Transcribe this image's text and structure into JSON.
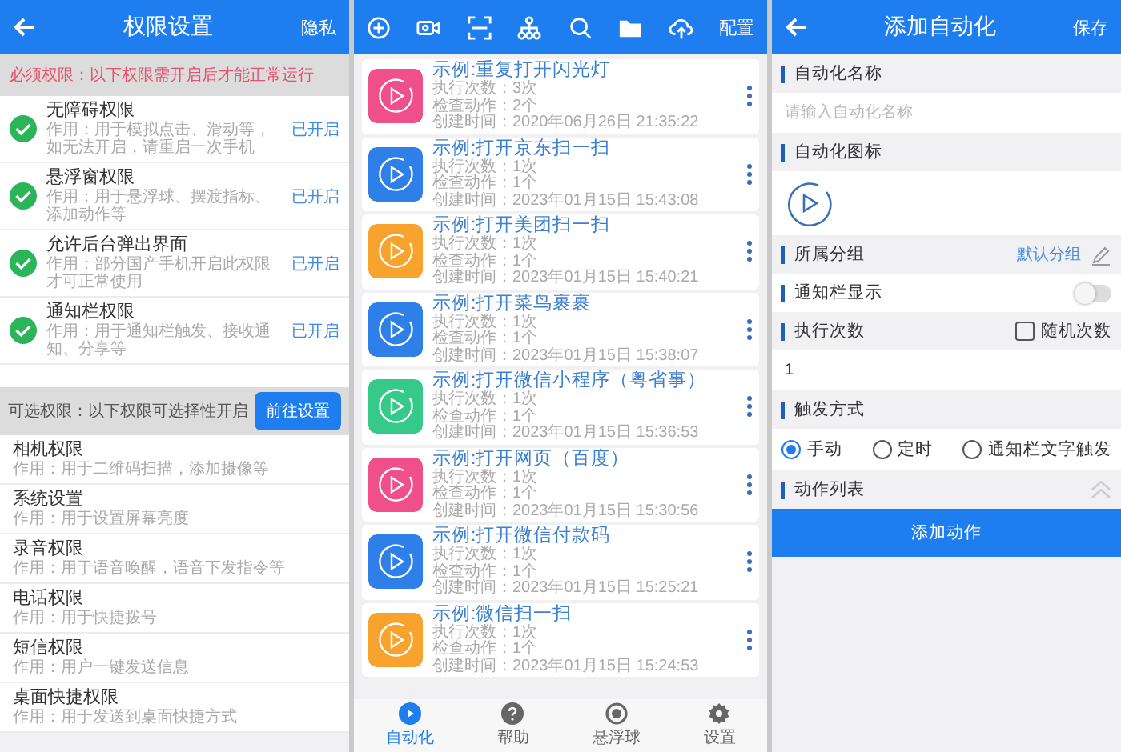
{
  "permissions_screen": {
    "title": "权限设置",
    "action": "隐私",
    "required_notice": "必须权限：以下权限需开启后才能正常运行",
    "required": [
      {
        "name": "无障碍权限",
        "description": "作用：用于模拟点击、滑动等，如无法开启，请重启一次手机",
        "status": "已开启",
        "granted": true
      },
      {
        "name": "悬浮窗权限",
        "description": "作用：用于悬浮球、摆渡指标、添加动作等",
        "status": "已开启",
        "granted": true
      },
      {
        "name": "允许后台弹出界面",
        "description": "作用：部分国产手机开启此权限才可正常使用",
        "status": "已开启",
        "granted": true
      },
      {
        "name": "通知栏权限",
        "description": "作用：用于通知栏触发、接收通知、分享等",
        "status": "已开启",
        "granted": true
      }
    ],
    "optional_notice": "可选权限：以下权限可选择性开启",
    "optional_button": "前往设置",
    "optional": [
      {
        "name": "相机权限",
        "description": "作用：用于二维码扫描，添加摄像等"
      },
      {
        "name": "系统设置",
        "description": "作用：用于设置屏幕亮度"
      },
      {
        "name": "录音权限",
        "description": "作用：用于语音唤醒，语音下发指令等"
      },
      {
        "name": "电话权限",
        "description": "作用：用于快捷拨号"
      },
      {
        "name": "短信权限",
        "description": "作用：用户一键发送信息"
      },
      {
        "name": "桌面快捷权限",
        "description": "作用：用于发送到桌面快捷方式"
      }
    ]
  },
  "automation_list": {
    "toolbar_label": "配置",
    "items": [
      {
        "title": "示例:重复打开闪光灯",
        "runs": "执行次数：3次",
        "checks": "检查动作：2个",
        "created": "创建时间：2020年06月26日 21:35:22",
        "color": "#f0508a"
      },
      {
        "title": "示例:打开京东扫一扫",
        "runs": "执行次数：1次",
        "checks": "检查动作：1个",
        "created": "创建时间：2023年01月15日 15:43:08",
        "color": "#2f7fe8"
      },
      {
        "title": "示例:打开美团扫一扫",
        "runs": "执行次数：1次",
        "checks": "检查动作：1个",
        "created": "创建时间：2023年01月15日 15:40:21",
        "color": "#f7a32e"
      },
      {
        "title": "示例:打开菜鸟裹裹",
        "runs": "执行次数：1次",
        "checks": "检查动作：1个",
        "created": "创建时间：2023年01月15日 15:38:07",
        "color": "#2f7fe8"
      },
      {
        "title": "示例:打开微信小程序（粤省事）",
        "runs": "执行次数：1次",
        "checks": "检查动作：1个",
        "created": "创建时间：2023年01月15日 15:36:53",
        "color": "#35c98a"
      },
      {
        "title": "示例:打开网页（百度）",
        "runs": "执行次数：1次",
        "checks": "检查动作：1个",
        "created": "创建时间：2023年01月15日 15:30:56",
        "color": "#f0508a"
      },
      {
        "title": "示例:打开微信付款码",
        "runs": "执行次数：1次",
        "checks": "检查动作：1个",
        "created": "创建时间：2023年01月15日 15:25:21",
        "color": "#2f7fe8"
      },
      {
        "title": "示例:微信扫一扫",
        "runs": "执行次数：1次",
        "checks": "检查动作：1个",
        "created": "创建时间：2023年01月15日 15:24:53",
        "color": "#f7a32e"
      }
    ],
    "nav": [
      {
        "label": "自动化",
        "selected": true
      },
      {
        "label": "帮助",
        "selected": false
      },
      {
        "label": "悬浮球",
        "selected": false
      },
      {
        "label": "设置",
        "selected": false
      }
    ]
  },
  "add_automation": {
    "title": "添加自动化",
    "action": "保存",
    "name_label": "自动化名称",
    "name_placeholder": "请输入自动化名称",
    "icon_label": "自动化图标",
    "group_label": "所属分组",
    "group_value": "默认分组",
    "notification_label": "通知栏显示",
    "notification_on": false,
    "count_label": "执行次数",
    "random_label": "随机次数",
    "random_checked": false,
    "count_value": "1",
    "trigger_label": "触发方式",
    "triggers": [
      {
        "label": "手动",
        "selected": true
      },
      {
        "label": "定时",
        "selected": false
      },
      {
        "label": "通知栏文字触发",
        "selected": false
      }
    ],
    "actions_label": "动作列表",
    "add_button": "添加动作"
  }
}
